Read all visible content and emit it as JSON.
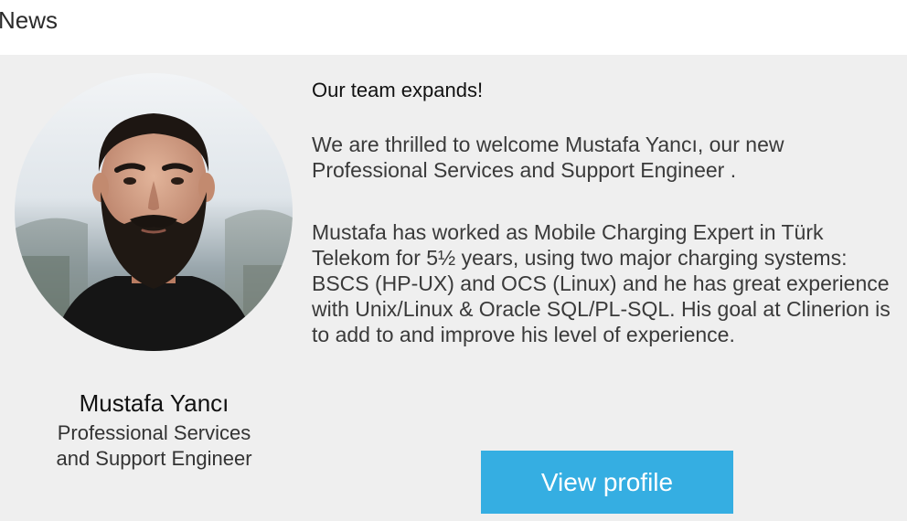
{
  "section": {
    "title": "News"
  },
  "person": {
    "name": "Mustafa Yancı",
    "role_line1": "Professional Services",
    "role_line2": "and Support Engineer"
  },
  "article": {
    "headline": "Our team expands!",
    "paragraph1": "We are thrilled to welcome Mustafa Yancı, our new Professional Services and Support Engineer .",
    "paragraph2": "Mustafa has worked as Mobile Charging Expert in Türk Telekom for 5½ years, using two major charging systems: BSCS (HP-UX) and OCS (Linux) and he has great experience with Unix/Linux & Oracle SQL/PL-SQL. His goal at Clinerion is to add to and improve his level of experience."
  },
  "cta": {
    "label": "View  profile"
  },
  "colors": {
    "card_background": "#efefef",
    "button_background": "#35aee2",
    "button_text": "#ffffff"
  }
}
